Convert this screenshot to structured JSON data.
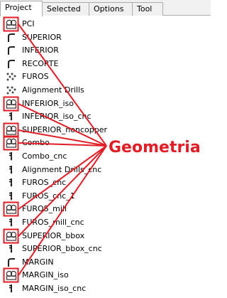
{
  "tabs": [
    {
      "label": "Project",
      "active": true
    },
    {
      "label": "Selected",
      "active": false
    },
    {
      "label": "Options",
      "active": false
    },
    {
      "label": "Tool",
      "active": false
    }
  ],
  "tree": [
    {
      "label": "PCI",
      "icon": "geometry-icon",
      "boxed": true
    },
    {
      "label": "SUPERIOR",
      "icon": "path-icon",
      "boxed": false
    },
    {
      "label": "INFERIOR",
      "icon": "path-icon",
      "boxed": false
    },
    {
      "label": "RECORTE",
      "icon": "path-icon",
      "boxed": false
    },
    {
      "label": "FUROS",
      "icon": "drill-points-icon",
      "boxed": false
    },
    {
      "label": "Alignment Drills",
      "icon": "drill-points-icon",
      "boxed": false
    },
    {
      "label": "INFERIOR_iso",
      "icon": "geometry-icon",
      "boxed": true
    },
    {
      "label": "INFERIOR_iso_cnc",
      "icon": "cnc-job-icon",
      "boxed": false
    },
    {
      "label": "SUPERIOR_noncopper",
      "icon": "geometry-icon",
      "boxed": true
    },
    {
      "label": "Combo",
      "icon": "geometry-icon",
      "boxed": true
    },
    {
      "label": "Combo_cnc",
      "icon": "cnc-job-icon",
      "boxed": false
    },
    {
      "label": "Alignment Drills_cnc",
      "icon": "cnc-job-icon",
      "boxed": false
    },
    {
      "label": "FUROS_cnc",
      "icon": "cnc-job-icon",
      "boxed": false
    },
    {
      "label": "FUROS_cnc_1",
      "icon": "cnc-job-icon",
      "boxed": false
    },
    {
      "label": "FUROS_mill",
      "icon": "geometry-icon",
      "boxed": true
    },
    {
      "label": "FUROS_mill_cnc",
      "icon": "cnc-job-icon",
      "boxed": false
    },
    {
      "label": "SUPERIOR_bbox",
      "icon": "geometry-icon",
      "boxed": true
    },
    {
      "label": "SUPERIOR_bbox_cnc",
      "icon": "cnc-job-icon",
      "boxed": false
    },
    {
      "label": "MARGIN",
      "icon": "path-icon",
      "boxed": false
    },
    {
      "label": "MARGIN_iso",
      "icon": "geometry-icon",
      "boxed": true
    },
    {
      "label": "MARGIN_iso_cnc",
      "icon": "cnc-job-icon",
      "boxed": false
    }
  ],
  "annotation": {
    "label": "Geometria",
    "color": "#e11d26"
  }
}
